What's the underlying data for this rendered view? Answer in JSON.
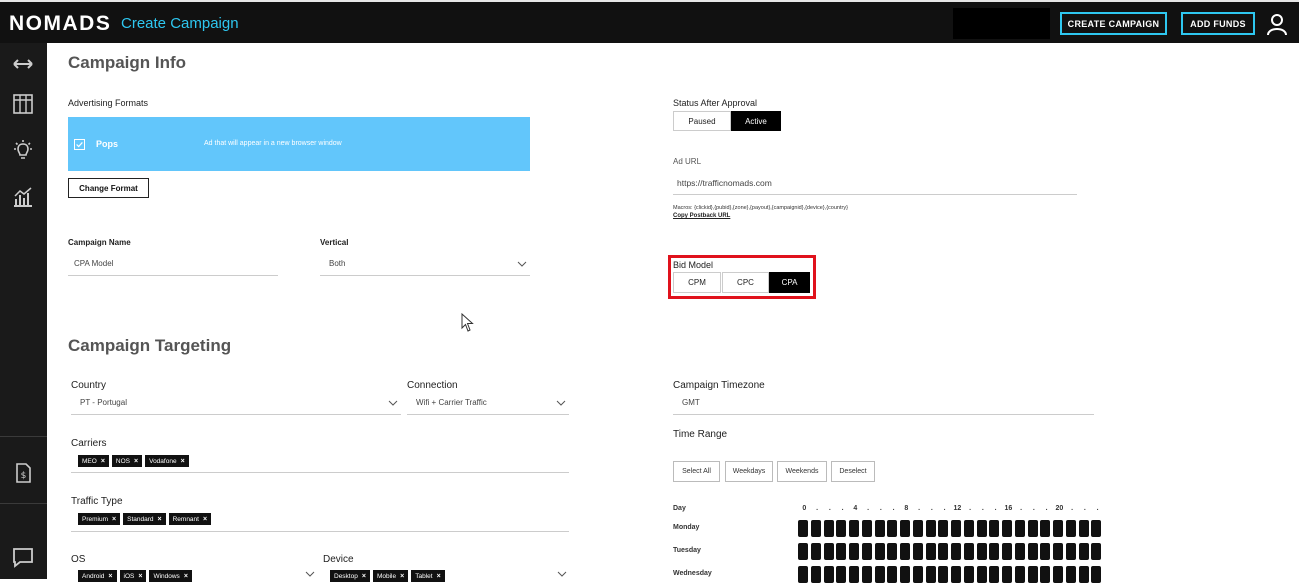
{
  "header": {
    "logo": "NOMADS",
    "page_title": "Create Campaign",
    "create_campaign_label": "CREATE CAMPAIGN",
    "add_funds_label": "ADD FUNDS",
    "accent_color": "#2ec7f0"
  },
  "sidebar": {
    "icons": [
      "arrows-horizontal-icon",
      "table-icon",
      "lightbulb-icon",
      "chart-icon",
      "dollar-document-icon",
      "chat-icon"
    ]
  },
  "campaign_info": {
    "title": "Campaign Info",
    "advertising_formats_label": "Advertising Formats",
    "format_name": "Pops",
    "format_description": "Ad that will appear in a new browser window",
    "format_card_color": "#62c6fb",
    "change_format_label": "Change Format",
    "campaign_name_label": "Campaign Name",
    "campaign_name_value": "CPA Model",
    "vertical_label": "Vertical",
    "vertical_value": "Both",
    "status_label": "Status After Approval",
    "status_options": [
      "Paused",
      "Active"
    ],
    "status_selected": "Active",
    "ad_url_label": "Ad URL",
    "ad_url_value": "https://trafficnomads.com",
    "macros_text": "Macros: {clickid},{pubid},{zone},{payout},{campaignid},{device},{country}",
    "copy_postback_label": "Copy Postback URL",
    "bid_model_label": "Bid Model",
    "bid_options": [
      "CPM",
      "CPC",
      "CPA"
    ],
    "bid_selected": "CPA",
    "highlight_color": "#e0121c"
  },
  "targeting": {
    "title": "Campaign Targeting",
    "country_label": "Country",
    "country_value": "PT - Portugal",
    "connection_label": "Connection",
    "connection_value": "Wifi + Carrier Traffic",
    "timezone_label": "Campaign Timezone",
    "timezone_value": "GMT",
    "carriers_label": "Carriers",
    "carriers": [
      "MEO",
      "NOS",
      "Vodafone"
    ],
    "time_range_label": "Time Range",
    "time_buttons": [
      "Select All",
      "Weekdays",
      "Weekends",
      "Deselect"
    ],
    "traffic_type_label": "Traffic Type",
    "traffic_types": [
      "Premium",
      "Standard",
      "Remnant"
    ],
    "os_label": "OS",
    "os_values": [
      "Android",
      "iOS",
      "Windows"
    ],
    "device_label": "Device",
    "device_values": [
      "Desktop",
      "Mobile",
      "Tablet"
    ],
    "chip_remove_glyph": "×",
    "schedule": {
      "day_header": "Day",
      "hour_ticks": [
        "0",
        ".",
        ".",
        ".",
        "4",
        ".",
        ".",
        ".",
        "8",
        ".",
        ".",
        ".",
        "12",
        ".",
        ".",
        ".",
        "16",
        ".",
        ".",
        ".",
        "20",
        ".",
        ".",
        "."
      ],
      "days": [
        "Monday",
        "Tuesday",
        "Wednesday"
      ],
      "hours_per_day": 24
    }
  }
}
